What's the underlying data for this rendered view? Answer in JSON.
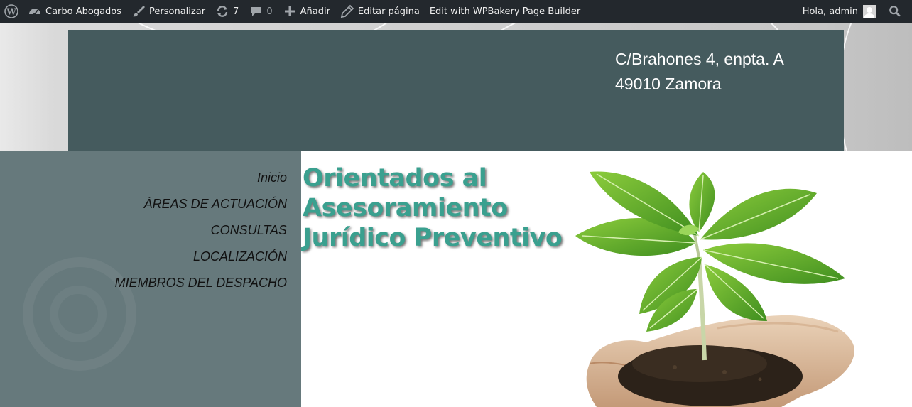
{
  "adminbar": {
    "site_name": "Carbo Abogados",
    "customize_label": "Personalizar",
    "updates_count": "7",
    "comments_count": "0",
    "new_label": "Añadir",
    "edit_page_label": "Editar página",
    "wpbakery_label": "Edit with WPBakery Page Builder",
    "greeting": "Hola, admin",
    "icons": {
      "wp": "wordpress-logo-icon",
      "site": "dashboard-icon",
      "customize": "paintbrush-icon",
      "updates": "refresh-icon",
      "comments": "comment-bubble-icon",
      "new": "plus-icon",
      "edit": "pencil-icon",
      "avatar": "user-avatar-icon",
      "search": "search-icon"
    }
  },
  "header": {
    "address_line1": "C/Brahones 4, enpta. A",
    "address_line2": "49010 Zamora"
  },
  "menu": {
    "items": [
      {
        "label": "Inicio"
      },
      {
        "label": "ÁREAS DE ACTUACIÓN"
      },
      {
        "label": "CONSULTAS"
      },
      {
        "label": "LOCALIZACIÓN"
      },
      {
        "label": "MIEMBROS DEL DESPACHO"
      }
    ]
  },
  "main": {
    "headline_line1": "Orientados al",
    "headline_line2": "Asesoramiento",
    "headline_line3": "Jurídico Preventivo"
  },
  "colors": {
    "adminbar_bg": "#23282d",
    "header_bg": "#455b5e",
    "sidebar_bg": "#66797c",
    "headline": "#3aa08f"
  }
}
